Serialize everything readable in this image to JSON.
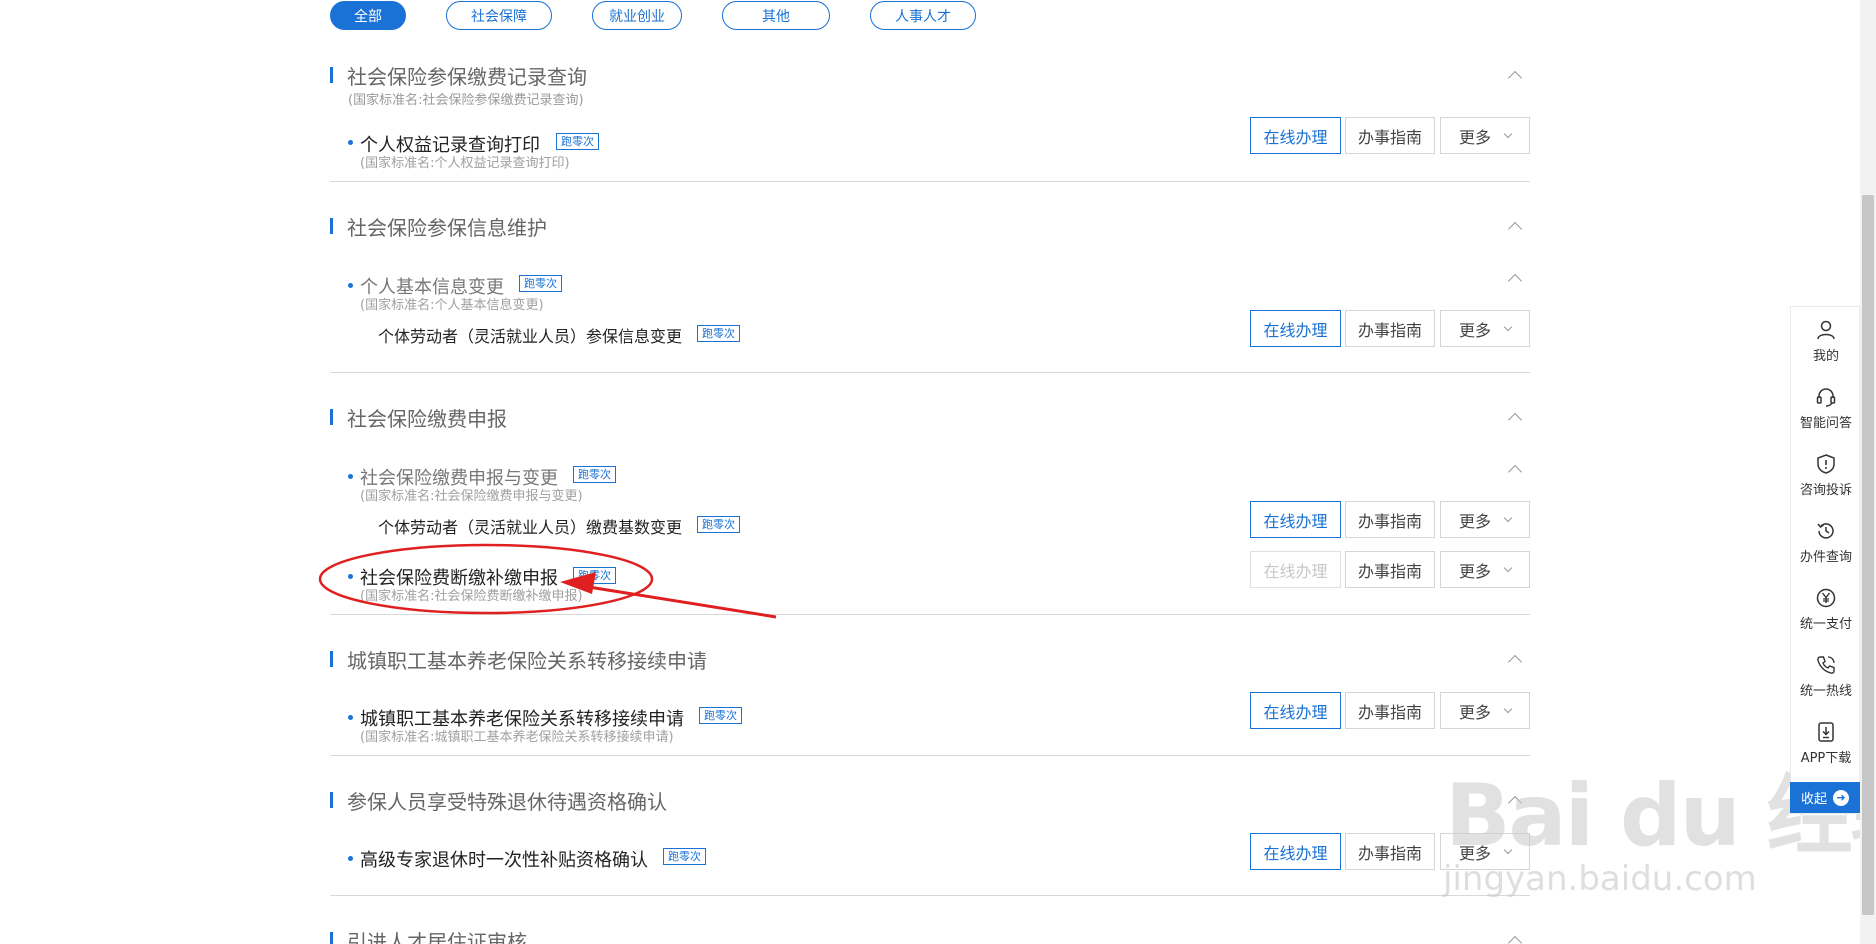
{
  "tabs": [
    {
      "label": "全部",
      "active": true
    },
    {
      "label": "社会保障",
      "active": false
    },
    {
      "label": "就业创业",
      "active": false
    },
    {
      "label": "其他",
      "active": false
    },
    {
      "label": "人事人才",
      "active": false
    }
  ],
  "buttons": {
    "online": "在线办理",
    "guide": "办事指南",
    "more": "更多"
  },
  "badge": "跑零次",
  "categories": [
    {
      "title": "社会保险参保缴费记录查询",
      "std": "(国家标准名:社会保险参保缴费记录查询)"
    },
    {
      "title": "社会保险参保信息维护"
    },
    {
      "title": "社会保险缴费申报"
    },
    {
      "title": "城镇职工基本养老保险关系转移接续申请"
    },
    {
      "title": "参保人员享受特殊退休待遇资格确认"
    },
    {
      "title": "引进人才居住证审核"
    }
  ],
  "items": [
    {
      "title": "个人权益记录查询打印",
      "std": "(国家标准名:个人权益记录查询打印)"
    },
    {
      "title": "个人基本信息变更",
      "std": "(国家标准名:个人基本信息变更)",
      "sub": "个体劳动者（灵活就业人员）参保信息变更"
    },
    {
      "title": "社会保险缴费申报与变更",
      "std": "(国家标准名:社会保险缴费申报与变更)",
      "sub": "个体劳动者（灵活就业人员）缴费基数变更"
    },
    {
      "title": "社会保险费断缴补缴申报",
      "std": "(国家标准名:社会保险费断缴补缴申报)"
    },
    {
      "title": "城镇职工基本养老保险关系转移接续申请",
      "std": "(国家标准名:城镇职工基本养老保险关系转移接续申请)"
    },
    {
      "title": "高级专家退休时一次性补贴资格确认"
    }
  ],
  "sidebar": {
    "items": [
      {
        "label": "我的",
        "icon": "user-icon"
      },
      {
        "label": "智能问答",
        "icon": "headset-icon"
      },
      {
        "label": "咨询投诉",
        "icon": "shield-alert-icon"
      },
      {
        "label": "办件查询",
        "icon": "history-icon"
      },
      {
        "label": "统一支付",
        "icon": "yen-icon"
      },
      {
        "label": "统一热线",
        "icon": "phone-icon"
      },
      {
        "label": "APP下载",
        "icon": "download-icon"
      }
    ],
    "collapse": "收起",
    "collapse_icon": "arrow-right-icon"
  },
  "watermark": {
    "brand": "Bai du 经验",
    "url": "jingyan.baidu.com"
  },
  "colors": {
    "accent": "#1a72d6",
    "annotation": "#e02020"
  }
}
